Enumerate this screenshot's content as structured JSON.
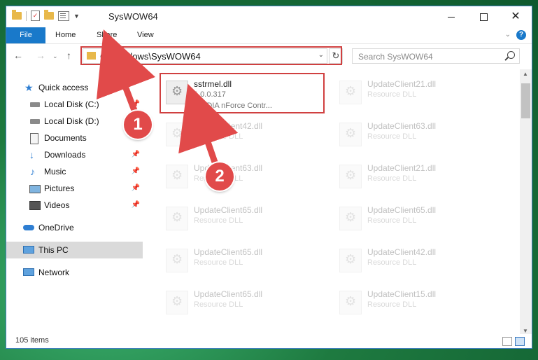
{
  "window": {
    "title": "SysWOW64"
  },
  "ribbon": {
    "file": "File",
    "home": "Home",
    "share": "Share",
    "view": "View"
  },
  "address": {
    "path": "C:\\Windows\\SysWOW64"
  },
  "search": {
    "placeholder": "Search SysWOW64"
  },
  "nav": {
    "quick_access": "Quick access",
    "local_c": "Local Disk (C:)",
    "local_d": "Local Disk (D:)",
    "documents": "Documents",
    "downloads": "Downloads",
    "music": "Music",
    "pictures": "Pictures",
    "videos": "Videos",
    "onedrive": "OneDrive",
    "this_pc": "This PC",
    "network": "Network"
  },
  "files": {
    "main": {
      "name": "sstrmel.dll",
      "version": "1.0.0.317",
      "desc": "NVIDIA nForce Contr..."
    },
    "r1": {
      "name": "UpdateClient21.dll",
      "type": "Resource DLL"
    },
    "l2": {
      "name": "UpdateClient42.dll",
      "type": "Resource DLL"
    },
    "r2": {
      "name": "UpdateClient63.dll",
      "type": "Resource DLL"
    },
    "l3": {
      "name": "UpdateClient63.dll",
      "type": "Resource DLL"
    },
    "r3": {
      "name": "UpdateClient21.dll",
      "type": "Resource DLL"
    },
    "l4": {
      "name": "UpdateClient65.dll",
      "type": "Resource DLL"
    },
    "r4": {
      "name": "UpdateClient65.dll",
      "type": "Resource DLL"
    },
    "l5": {
      "name": "UpdateClient65.dll",
      "type": "Resource DLL"
    },
    "r5": {
      "name": "UpdateClient42.dll",
      "type": "Resource DLL"
    },
    "l6": {
      "name": "UpdateClient65.dll",
      "type": "Resource DLL"
    },
    "r6": {
      "name": "UpdateClient15.dll",
      "type": "Resource DLL"
    }
  },
  "status": {
    "count": "105 items"
  },
  "annotations": {
    "step1": "1",
    "step2": "2"
  },
  "colors": {
    "accent": "#1979ca",
    "highlight": "#d04040",
    "badge": "#e14a4a"
  }
}
